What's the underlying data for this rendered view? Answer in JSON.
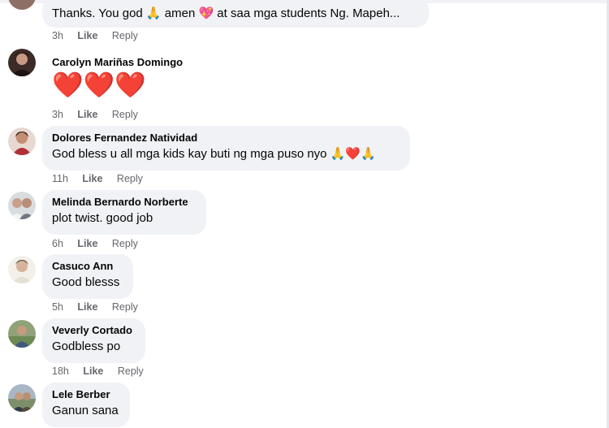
{
  "comments": [
    {
      "author": "",
      "text": "Thanks. You god 🙏 amen 💖 at saa mga students Ng. Mapeh...",
      "time": "3h",
      "like_label": "Like",
      "reply_label": "Reply"
    },
    {
      "author": "Carolyn Mariñas Domingo",
      "text": "❤️❤️❤️",
      "time": "3h",
      "like_label": "Like",
      "reply_label": "Reply"
    },
    {
      "author": "Dolores Fernandez Natividad",
      "text": "God bless u all mga kids kay buti ng mga puso nyo 🙏❤️🙏",
      "time": "11h",
      "like_label": "Like",
      "reply_label": "Reply"
    },
    {
      "author": "Melinda Bernardo Norberte",
      "text": "plot twist. good job",
      "time": "6h",
      "like_label": "Like",
      "reply_label": "Reply"
    },
    {
      "author": "Casuco Ann",
      "text": "Good blesss",
      "time": "5h",
      "like_label": "Like",
      "reply_label": "Reply"
    },
    {
      "author": "Veverly Cortado",
      "text": "Godbless po",
      "time": "18h",
      "like_label": "Like",
      "reply_label": "Reply"
    },
    {
      "author": "Lele Berber",
      "text": "Ganun sana",
      "time": "",
      "like_label": "",
      "reply_label": ""
    }
  ],
  "colors": {
    "bubble": "#f0f2f5",
    "meta": "#65676b",
    "heart": "#e41e3f"
  }
}
